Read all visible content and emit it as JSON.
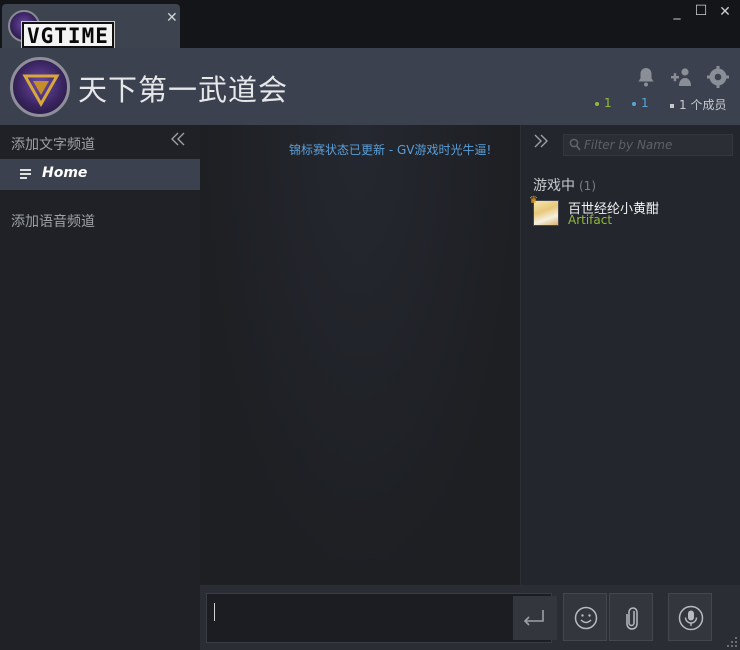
{
  "tab": {
    "logo_text": "VGTIME",
    "close_glyph": "✕"
  },
  "window_controls": {
    "minimize": "_",
    "maximize": "☐",
    "close": "✕"
  },
  "header": {
    "title": "天下第一武道会",
    "icons": [
      "bell-icon",
      "add-friend-icon",
      "settings-gear-icon"
    ],
    "stats": {
      "ingame_count": "1",
      "online_count": "1",
      "members_label": "1 个成员",
      "ingame_color": "#90ba3c",
      "online_color": "#57a7d9",
      "members_color": "#c7c9cc"
    }
  },
  "sidebar": {
    "text_channel_label": "添加文字频道",
    "collapse_glyph": "《",
    "home_label": "Home",
    "voice_channel_label": "添加语音频道"
  },
  "chat": {
    "system_message": "锦标赛状态已更新 - GV游戏时光牛逼!"
  },
  "members": {
    "expand_glyph": "》",
    "filter_placeholder": "Filter by Name",
    "ingame_heading": "游戏中",
    "ingame_count": "(1)",
    "list": [
      {
        "name": "百世经纶小黄酣",
        "game": "Artifact",
        "is_owner": true
      }
    ]
  },
  "input": {
    "message_value": "",
    "send_icon": "enter-icon",
    "emoticon_icon": "smiley-icon",
    "attach_icon": "paperclip-icon",
    "voice_icon": "microphone-icon"
  },
  "colors": {
    "accent_blue": "#57a7d9",
    "game_green": "#90ba3c",
    "header_bg": "#3c4150",
    "panel_bg": "#1f2126"
  }
}
